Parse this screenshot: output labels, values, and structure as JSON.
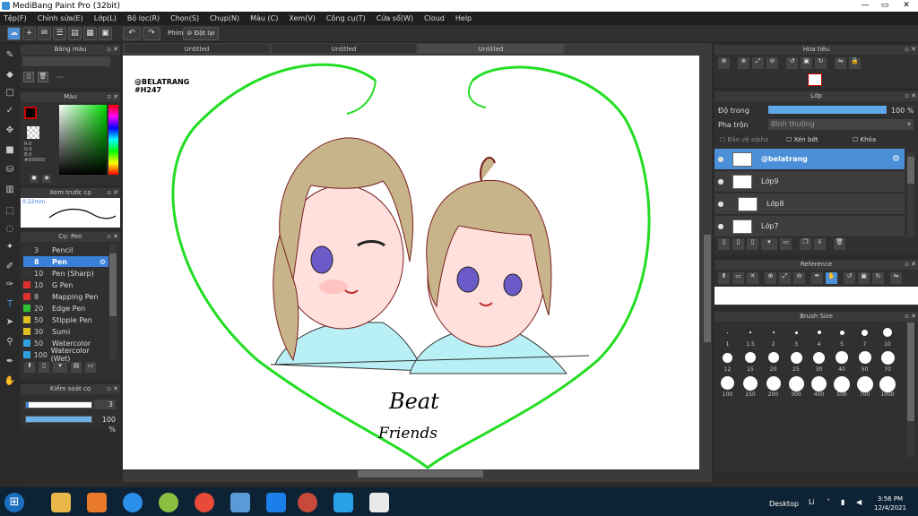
{
  "window": {
    "title": "MediBang Paint Pro (32bit)"
  },
  "menu": [
    "Tệp(F)",
    "Chỉnh sửa(E)",
    "Lớp(L)",
    "Bộ lọc(R)",
    "Chọn(S)",
    "Chụp(N)",
    "Màu (C)",
    "Xem(V)",
    "Công cụ(T)",
    "Cửa sổ(W)",
    "Cloud",
    "Help"
  ],
  "toolbar": {
    "snap_label": "Phím",
    "reset_label": "Đặt lại"
  },
  "tabs": [
    "Untitled",
    "Untitled",
    "Untitled"
  ],
  "panels": {
    "palette": "Bảng màu",
    "color": "Màu",
    "brush_preview": "Xem trước cọ",
    "brush": "Cọ: Pen",
    "brush_control": "Kiểm soát cọ",
    "navigator": "Hoa tiêu",
    "layer": "Lớp",
    "reference": "Reference",
    "brush_size": "Brush Size"
  },
  "palette": {
    "more": "···"
  },
  "color": {
    "r": "R:0",
    "g": "G:0",
    "b": "B:0",
    "hex": "#000000",
    "primary": "#cc0000",
    "secondary": "#ffffff"
  },
  "brush_preview": {
    "size": "0.22mm"
  },
  "brushes": [
    {
      "num": "3",
      "name": "Pencil",
      "color": "#333333"
    },
    {
      "num": "8",
      "name": "Pen",
      "color": "#3a7fd9"
    },
    {
      "num": "10",
      "name": "Pen (Sharp)",
      "color": "#333333"
    },
    {
      "num": "10",
      "name": "G Pen",
      "color": "#e03030"
    },
    {
      "num": "8",
      "name": "Mapping Pen",
      "color": "#e03030"
    },
    {
      "num": "20",
      "name": "Edge Pen",
      "color": "#30c030"
    },
    {
      "num": "50",
      "name": "Stipple Pen",
      "color": "#e0c020"
    },
    {
      "num": "30",
      "name": "Sumi",
      "color": "#e0c020"
    },
    {
      "num": "50",
      "name": "Watercolor",
      "color": "#30a0e0"
    },
    {
      "num": "100",
      "name": "Watercolor (Wet)",
      "color": "#30a0e0"
    }
  ],
  "brush_control": {
    "size": "3",
    "opacity": "100 %"
  },
  "layer": {
    "opacity_label": "Độ trong",
    "opacity_value": "100 %",
    "blend_label": "Pha trộn",
    "blend_value": "Bình thường",
    "protect_alpha": "Bảo vệ alpha",
    "clip": "Xén bớt",
    "lock": "Khóa",
    "layers": [
      "@belatrang",
      "Lớp9",
      "Lớp8",
      "Lớp7"
    ]
  },
  "brush_sizes": [
    "1",
    "1.5",
    "2",
    "3",
    "4",
    "5",
    "7",
    "10",
    "12",
    "15",
    "20",
    "25",
    "30",
    "40",
    "50",
    "70",
    "100",
    "150",
    "200",
    "300",
    "400",
    "500",
    "700",
    "1000"
  ],
  "canvas": {
    "watermark1": "@BELATRANG",
    "watermark2": "#H247",
    "text1": "Beat",
    "text2": "Friends"
  },
  "taskbar": {
    "desktop": "Desktop",
    "lang": "Li",
    "time": "3:56 PM",
    "date": "12/4/2021"
  },
  "colors": {
    "heart": "#22dd22",
    "shirt": "#b8f0f5",
    "hair": "#c8b48a",
    "highlight": "#4a8fd8"
  }
}
